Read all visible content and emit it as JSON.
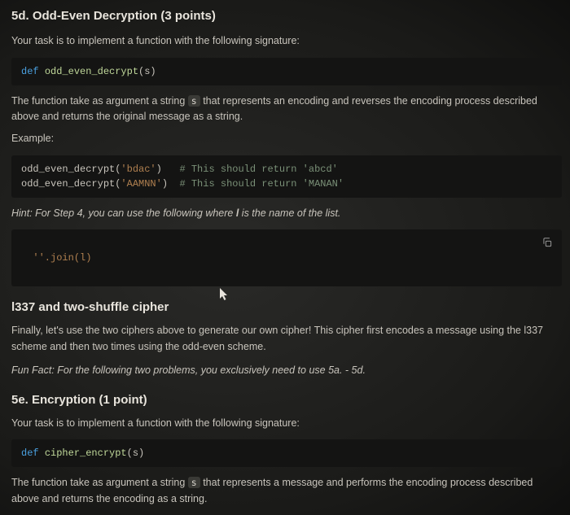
{
  "sec5d": {
    "heading": "5d. Odd-Even Decryption (3 points)",
    "intro": "Your task is to implement a function with the following signature:",
    "sig_def": "def ",
    "sig_fn": "odd_even_decrypt",
    "sig_tail": "(s)",
    "desc_pre": "The function take as argument a string ",
    "desc_var": "s",
    "desc_post": " that represents an encoding and reverses the encoding process described above and returns the original message as a string.",
    "example_label": "Example:",
    "ex_fn1": "odd_even_decrypt(",
    "ex_arg1": "'bdac'",
    "ex_close1": ")   ",
    "ex_cmt1": "# This should return 'abcd'",
    "ex_fn2": "odd_even_decrypt(",
    "ex_arg2": "'AAMNN'",
    "ex_close2": ")  ",
    "ex_cmt2": "# This should return 'MANAN'",
    "hint_pre": "Hint: For Step 4, you can use the following where ",
    "hint_var": "l",
    "hint_post": " is the name of the list.",
    "join_code": "''.join(l)"
  },
  "cipher": {
    "heading": "l337 and two-shuffle cipher",
    "body": "Finally, let's use the two ciphers above to generate our own cipher! This cipher first encodes a message using the l337 scheme and then two times using the odd-even scheme.",
    "funfact": "Fun Fact: For the following two problems, you exclusively need to use 5a. - 5d."
  },
  "sec5e": {
    "heading": "5e. Encryption (1 point)",
    "intro": "Your task is to implement a function with the following signature:",
    "sig_def": "def ",
    "sig_fn": "cipher_encrypt",
    "sig_tail": "(s)",
    "desc_pre": "The function take as argument a string ",
    "desc_var": "s",
    "desc_post": " that represents a message and performs the encoding process described above and returns the encoding as a string."
  }
}
